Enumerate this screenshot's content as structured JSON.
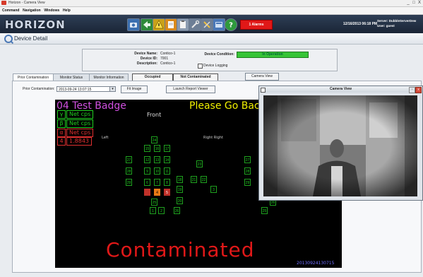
{
  "window": {
    "title": "Horizon - Camera View",
    "controls": [
      "_",
      "□",
      "X"
    ]
  },
  "menu": [
    "Command",
    "Navigation",
    "Windows",
    "Help"
  ],
  "toolbar": {
    "logo": "HORIZON",
    "alarms_label": "1 Alarms",
    "datetime": "12/16/2013 06:18 PM",
    "server_line": "Server: DubbleServerDew",
    "user_line": "User: guest",
    "icons": [
      "camera-icon",
      "back-arrow-icon",
      "warning-icon",
      "document-icon",
      "clipboard-icon",
      "wrench-icon",
      "tools-icon",
      "settings-icon",
      "help-icon"
    ]
  },
  "page": {
    "title": "Device Detail"
  },
  "device": {
    "name_label": "Device Name:",
    "name_value": "Contico-1",
    "id_label": "Device ID:",
    "id_value": "7001",
    "desc_label": "Description:",
    "desc_value": "Contico-1",
    "condition_label": "Device Condition:",
    "condition_value": "In Operation",
    "logging_label": "Device Logging",
    "condition_color": "#37c437"
  },
  "tabs": [
    "Prior Contamination",
    "Monitor Status",
    "Monitor Information"
  ],
  "status_boxes": [
    "Occupied",
    "Not Contaminated"
  ],
  "camera_view_button": "Camera View",
  "prior": {
    "label": "Prior Contamination:",
    "selected": "2013-09-24 13:07:15",
    "fit_image_button": "Fit Image",
    "launch_report_button": "Launch Report Viewer"
  },
  "detector": {
    "badge_text": "04 Test Badge",
    "banner_text": "Please Go Bac",
    "front_label": "Front",
    "left_label": "Left",
    "right_label": "Right Right",
    "legend": [
      {
        "sym": "γ",
        "text": "Net cps",
        "color": "#20d020"
      },
      {
        "sym": "β",
        "text": "Net cps",
        "color": "#20d020"
      },
      {
        "sym": "α",
        "text": "Net cps",
        "color": "#e03030"
      }
    ],
    "reading_index": "4",
    "reading_value": "1.8843",
    "result_text": "Contaminated",
    "timestamp": "20130924130715"
  },
  "camera_window": {
    "title": "Camera View"
  },
  "cells": [
    {
      "n": "24",
      "t": ""
    },
    {
      "n": "15",
      "t": ""
    },
    {
      "n": "16",
      "t": ""
    },
    {
      "n": "17",
      "t": ""
    },
    {
      "n": "27",
      "t": ""
    },
    {
      "n": "12",
      "t": ""
    },
    {
      "n": "13",
      "t": ""
    },
    {
      "n": "14",
      "t": ""
    },
    {
      "n": "28",
      "t": ""
    },
    {
      "n": "9",
      "t": ""
    },
    {
      "n": "10",
      "t": ""
    },
    {
      "n": "11",
      "t": ""
    },
    {
      "n": "29",
      "t": ""
    },
    {
      "n": "6",
      "t": ""
    },
    {
      "n": "7",
      "t": ""
    },
    {
      "n": "8",
      "t": ""
    },
    {
      "n": "",
      "t": "warm"
    },
    {
      "n": "4",
      "t": "hot"
    },
    {
      "n": "5",
      "t": "warm"
    },
    {
      "n": "25",
      "t": ""
    },
    {
      "n": "1",
      "t": ""
    },
    {
      "n": "2",
      "t": ""
    },
    {
      "n": "18",
      "t": ""
    },
    {
      "n": "21",
      "t": ""
    },
    {
      "n": "22",
      "t": ""
    },
    {
      "n": "19",
      "t": ""
    },
    {
      "n": "20",
      "t": ""
    },
    {
      "n": "23",
      "t": ""
    },
    {
      "n": "26",
      "t": ""
    },
    {
      "n": "3",
      "t": ""
    },
    {
      "n": "27",
      "t": ""
    },
    {
      "n": "28",
      "t": ""
    },
    {
      "n": "29",
      "t": ""
    },
    {
      "n": "25",
      "t": ""
    },
    {
      "n": "26",
      "t": ""
    }
  ]
}
